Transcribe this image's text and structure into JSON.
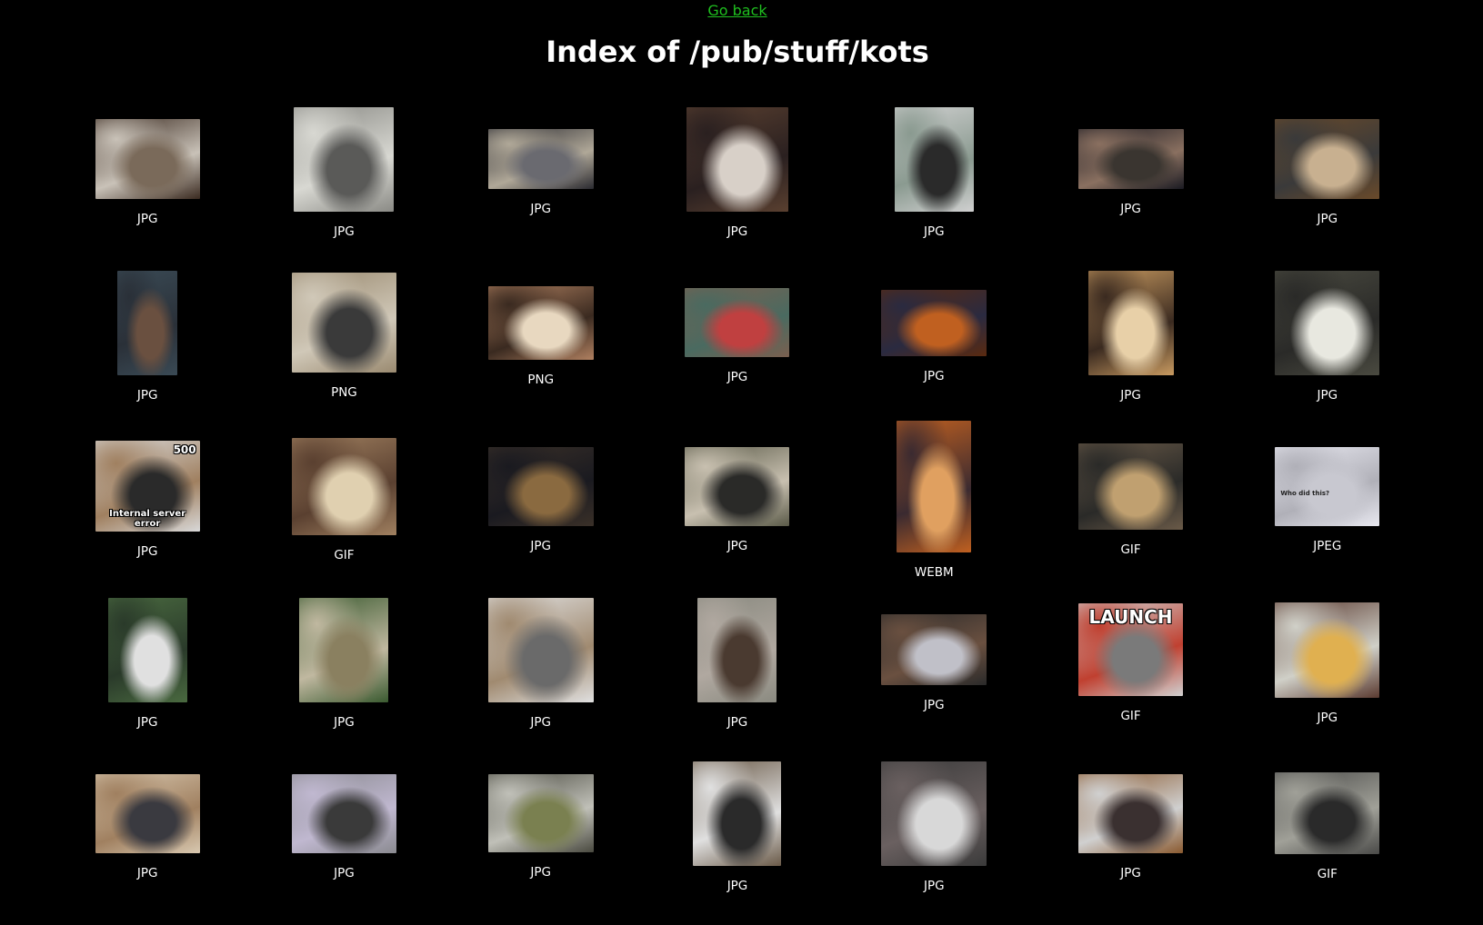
{
  "nav": {
    "back_label": "Go back"
  },
  "page": {
    "title": "Index of /pub/stuff/kots"
  },
  "colors": {
    "background": "#000000",
    "link": "#1fbf1f",
    "text": "#ffffff"
  },
  "items": [
    {
      "type": "JPG",
      "icon": "cat-at-desk-photo"
    },
    {
      "type": "JPG",
      "icon": "grey-cat-lying-photo"
    },
    {
      "type": "JPG",
      "icon": "cat-on-keyboard-photo"
    },
    {
      "type": "JPG",
      "icon": "calico-cat-on-logs-photo"
    },
    {
      "type": "JPG",
      "icon": "black-white-cat-photo"
    },
    {
      "type": "JPG",
      "icon": "cat-on-keyboard-dark-photo"
    },
    {
      "type": "JPG",
      "icon": "cat-on-computer-tower-photo"
    },
    {
      "type": "JPG",
      "icon": "cat-in-box-photo"
    },
    {
      "type": "PNG",
      "icon": "cats-in-box-pile-photo"
    },
    {
      "type": "PNG",
      "icon": "cats-peeking-from-box-photo"
    },
    {
      "type": "JPG",
      "icon": "cat-under-blanket-photo"
    },
    {
      "type": "JPG",
      "icon": "fantasy-art-image"
    },
    {
      "type": "JPG",
      "icon": "cat-closeup-photo"
    },
    {
      "type": "JPG",
      "icon": "cat-with-mask-photo"
    },
    {
      "type": "JPG",
      "icon": "cat-server-meme",
      "caption_top": "500",
      "caption_bottom": "Internal server error"
    },
    {
      "type": "GIF",
      "icon": "cats-playing-gif"
    },
    {
      "type": "JPG",
      "icon": "cat-on-laptop-desk-photo"
    },
    {
      "type": "JPG",
      "icon": "cat-in-basket-photo"
    },
    {
      "type": "WEBM",
      "icon": "cat-paw-video"
    },
    {
      "type": "GIF",
      "icon": "tabby-cat-gif"
    },
    {
      "type": "JPEG",
      "icon": "snow-cat-photo",
      "caption_text": "Who did this?"
    },
    {
      "type": "JPG",
      "icon": "white-cat-window-photo"
    },
    {
      "type": "JPG",
      "icon": "cat-in-tree-photo"
    },
    {
      "type": "JPG",
      "icon": "cat-thumbs-up-photo"
    },
    {
      "type": "JPG",
      "icon": "cat-in-alley-photo"
    },
    {
      "type": "JPG",
      "icon": "cat-with-macbook-photo"
    },
    {
      "type": "GIF",
      "icon": "cat-launch-button-gif",
      "caption_top": "LAUNCH"
    },
    {
      "type": "JPG",
      "icon": "cat-with-pancakes-photo"
    },
    {
      "type": "JPG",
      "icon": "cat-on-laptop-photo"
    },
    {
      "type": "JPG",
      "icon": "cat-on-bed-computer-photo"
    },
    {
      "type": "JPG",
      "icon": "cat-on-street-photo"
    },
    {
      "type": "JPG",
      "icon": "kittens-in-basket-photo"
    },
    {
      "type": "JPG",
      "icon": "cat-on-keyboard-closeup-photo"
    },
    {
      "type": "JPG",
      "icon": "cat-on-floor-photo"
    },
    {
      "type": "GIF",
      "icon": "cat-in-store-gif"
    }
  ]
}
